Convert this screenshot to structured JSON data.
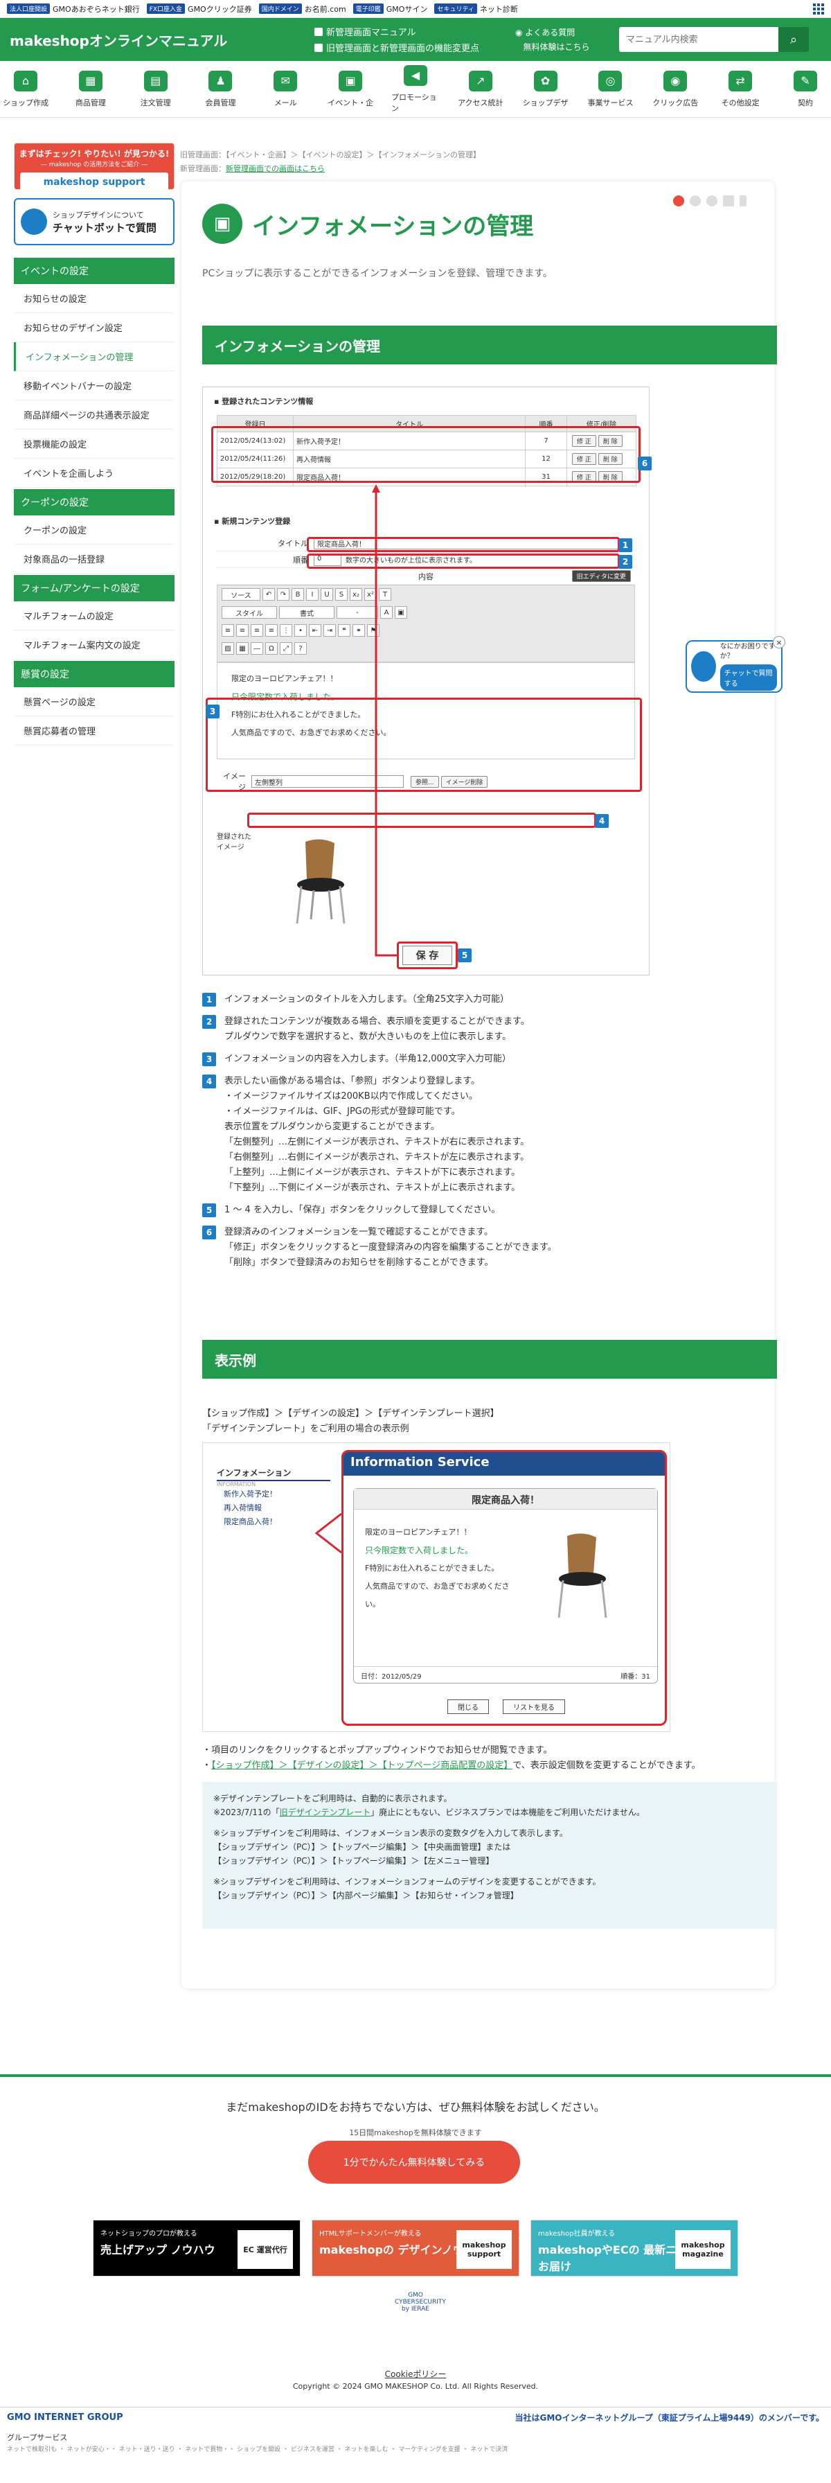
{
  "gmobar": {
    "items": [
      {
        "tag": "法人口座開設",
        "text": "GMOあおぞらネット銀行"
      },
      {
        "tag": "FX口座入金",
        "text": "GMOクリック証券"
      },
      {
        "tag": "国内ドメイン",
        "text": "お名前.com"
      },
      {
        "tag": "電子印鑑",
        "text": "GMOサイン"
      },
      {
        "tag": "セキュリティ",
        "text": "ネット診断"
      }
    ]
  },
  "header": {
    "logo": "makeshopオンラインマニュアル",
    "link_new": "新管理画面マニュアル",
    "link_compare": "旧管理画面と新管理画面の機能変更点",
    "faq": "よくある質問",
    "trial": "無料体験はこちら",
    "search_placeholder": "マニュアル内検索",
    "search_icon": "search-icon"
  },
  "gnav": [
    {
      "label": "ショップ作成",
      "icon": "⌂"
    },
    {
      "label": "商品管理",
      "icon": "▦"
    },
    {
      "label": "注文管理",
      "icon": "▤"
    },
    {
      "label": "会員管理",
      "icon": "♟"
    },
    {
      "label": "メール",
      "icon": "✉"
    },
    {
      "label": "イベント・企",
      "icon": "▣"
    },
    {
      "label": "プロモーション",
      "icon": "◀"
    },
    {
      "label": "アクセス統計",
      "icon": "↗"
    },
    {
      "label": "ショップデザ",
      "icon": "✿"
    },
    {
      "label": "事業サービス",
      "icon": "◎"
    },
    {
      "label": "クリック広告",
      "icon": "◉"
    },
    {
      "label": "その他設定",
      "icon": "⇄"
    },
    {
      "label": "契約",
      "icon": "✎"
    }
  ],
  "sidebar": {
    "banner1_top": "まずはチェック! やりたい! が見つかる!",
    "banner1_sub": "― makeshop の活用方法をご紹介 ―",
    "banner1_brand": "makeshop support",
    "banner2_top": "ショップデザインについて",
    "banner2_main": "チャットボットで質問",
    "sections": [
      {
        "title": "イベントの設定",
        "items": [
          "お知らせの設定",
          "お知らせのデザイン設定",
          "インフォメーションの管理",
          "移動イベントバナーの設定",
          "商品詳細ページの共通表示設定",
          "投票機能の設定",
          "イベントを企画しよう"
        ]
      },
      {
        "title": "クーポンの設定",
        "items": [
          "クーポンの設定",
          "対象商品の一括登録"
        ]
      },
      {
        "title": "フォーム/アンケートの設定",
        "items": [
          "マルチフォームの設定",
          "マルチフォーム案内文の設定"
        ]
      },
      {
        "title": "懸賞の設定",
        "items": [
          "懸賞ページの設定",
          "懸賞応募者の管理"
        ]
      }
    ]
  },
  "breadcrumb": {
    "line1": "旧管理画面：【イベント・企画】＞【イベントの設定】＞【インフォメーションの管理】",
    "line2_prefix": "新管理画面：",
    "line2_link": "新管理画面での画面はこちら"
  },
  "main": {
    "title": "インフォメーションの管理",
    "lead": "PCショップに表示することができるインフォメーションを登録、管理できます。",
    "section1": "インフォメーションの管理",
    "section2": "表示例"
  },
  "shot1": {
    "registered_head": "▪ 登録されたコンテンツ情報",
    "columns": [
      "登録日",
      "タイトル",
      "順番",
      "修正/削除"
    ],
    "rows": [
      {
        "date": "2012/05/24(13:02)",
        "title": "新作入荷予定！",
        "order": "7"
      },
      {
        "date": "2012/05/24(11:26)",
        "title": "再入荷情報",
        "order": "12"
      },
      {
        "date": "2012/05/29(18:20)",
        "title": "限定商品入荷！",
        "order": "31"
      }
    ],
    "edit_btn": "修 正",
    "delete_btn": "削 除",
    "new_head": "▪ 新規コンテンツ登録",
    "title_label": "タイトル",
    "title_value": "限定商品入荷！",
    "order_label": "順番",
    "order_value": "0",
    "order_note": "数字の大きいものが上位に表示されます。",
    "content_label": "内容",
    "old_editor_btn": "旧エディタに変更",
    "source_btn": "ソース",
    "style_select": "スタイル",
    "format_select": "書式",
    "editor_line1": "限定のヨーロピアンチェア！！",
    "editor_line2": "只今限定数で入荷しました。",
    "editor_line3": "F特別にお仕入れることができました。",
    "editor_line4": "人気商品ですので、お急ぎでお求めください。",
    "image_label": "イメージ",
    "image_select": "左側整列",
    "browse_btn": "参照...",
    "image_delete_btn": "イメージ削除",
    "registered_image_label": "登録された\nイメージ",
    "save_btn": "保 存",
    "badges": [
      "1",
      "2",
      "3",
      "4",
      "5",
      "6"
    ]
  },
  "steps": [
    {
      "n": "1",
      "text": "インフォメーションのタイトルを入力します。（全角25文字入力可能）"
    },
    {
      "n": "2",
      "text": "登録されたコンテンツが複数ある場合、表示順を変更することができます。\nプルダウンで数字を選択すると、数が大きいものを上位に表示します。"
    },
    {
      "n": "3",
      "text": "インフォメーションの内容を入力します。（半角12,000文字入力可能）"
    },
    {
      "n": "4",
      "text": "表示したい画像がある場合は、「参照」ボタンより登録します。\n・イメージファイルサイズは200KB以内で作成してください。\n・イメージファイルは、GIF、JPGの形式が登録可能です。\n表示位置をプルダウンから変更することができます。\n「左側整列」…左側にイメージが表示され、テキストが右に表示されます。\n「右側整列」…右側にイメージが表示され、テキストが左に表示されます。\n「上整列」…上側にイメージが表示され、テキストが下に表示されます。\n「下整列」…下側にイメージが表示され、テキストが上に表示されます。"
    },
    {
      "n": "5",
      "text": "1 〜 4 を入力し、「保存」ボタンをクリックして登録してください。"
    },
    {
      "n": "6",
      "text": "登録済みのインフォメーションを一覧で確認することができます。\n「修正」ボタンをクリックすると一度登録済みの内容を編集することができます。\n「削除」ボタンで登録済みのお知らせを削除することができます。"
    }
  ],
  "example": {
    "lead": "【ショップ作成】＞【デザインの設定】＞【デザインテンプレート選択】\n「デザインテンプレート」をご利用の場合の表示例",
    "side_title": "インフォメーション",
    "side_sub": "INFORMATION",
    "side_items": [
      "新作入荷予定！",
      "再入荷情報",
      "限定商品入荷！"
    ],
    "window_title": "Information Service",
    "panel_title": "限定商品入荷！",
    "line1": "限定のヨーロピアンチェア！！",
    "line2": "只今限定数で入荷しました。",
    "line3": "F特別にお仕入れることができました。",
    "line4": "人気商品ですので、お急ぎでお求めください。",
    "date_label": "日付：2012/05/29",
    "count_label": "順番：31",
    "close_btn": "閉じる",
    "list_btn": "リストを見る"
  },
  "bullets": {
    "b1": "・項目のリンクをクリックするとポップアップウィンドウでお知らせが閲覧できます。",
    "b2_prefix": "・",
    "b2_link": "【ショップ作成】＞【デザインの設定】＞【トップページ商品配置の設定】",
    "b2_suffix": "で、表示設定個数を変更することができます。"
  },
  "notes": {
    "n1a": "※デザインテンプレートをご利用時は、自動的に表示されます。",
    "n1b_prefix": "※2023/7/11の「",
    "n1b_link": "旧デザインテンプレート",
    "n1b_suffix": "」廃止にともない、ビジネスプランでは本機能をご利用いただけません。",
    "n2": "※ショップデザインをご利用時は、インフォメーション表示の変数タグを入力して表示します。\n【ショップデザイン（PC）】＞【トップページ編集】＞【中央画面管理】または\n【ショップデザイン（PC）】＞【トップページ編集】＞【左メニュー管理】",
    "n3": "※ショップデザインをご利用時は、インフォメーションフォームのデザインを変更することができます。\n【ショップデザイン（PC）】＞【内部ページ編集】＞【お知らせ・インフォ管理】"
  },
  "chat_float": {
    "text": "なにかお困りですか？",
    "button": "チャットで質問する"
  },
  "footer": {
    "cta_text": "まだmakeshopのIDをお持ちでない方は、ぜひ無料体験をお試しください。",
    "cta_sub": "15日間makeshopを無料体験できます",
    "cta_btn": "1分でかんたん無料体験してみる",
    "fb1_small": "ネットショップのプロが教える",
    "fb1_main": "売上げアップ ノウハウ",
    "fb1_box": "EC 運営代行",
    "fb2_small": "HTMLサポートメンバーが教える",
    "fb2_main": "makeshopの デザインノウハウ",
    "fb2_box": "makeshop support",
    "fb3_small": "makeshop社員が教える",
    "fb3_main": "makeshopやECの 最新ニュースをお届け",
    "fb3_box": "makeshop magazine",
    "seal": "GMO CYBERSECURITY by IERAE",
    "policy": "Cookieポリシー",
    "copyright": "Copyright © 2024 GMO MAKESHOP Co. Ltd. All Rights Reserved.",
    "gmo_logo": "GMO INTERNET GROUP",
    "gmo_member": "当社はGMOインターネットグループ（東証プライム上場9449）のメンバーです。",
    "group_title": "グループサービス",
    "group_links": "ネットで株取引も ・ ネットが安心・・ ネット・送り・送り ・ ネットで買物・・ ショップを開設 ・ ビジネスを運営 ・ ネットを楽しむ ・ マーケティングを支援 ・ ネットで決済"
  }
}
